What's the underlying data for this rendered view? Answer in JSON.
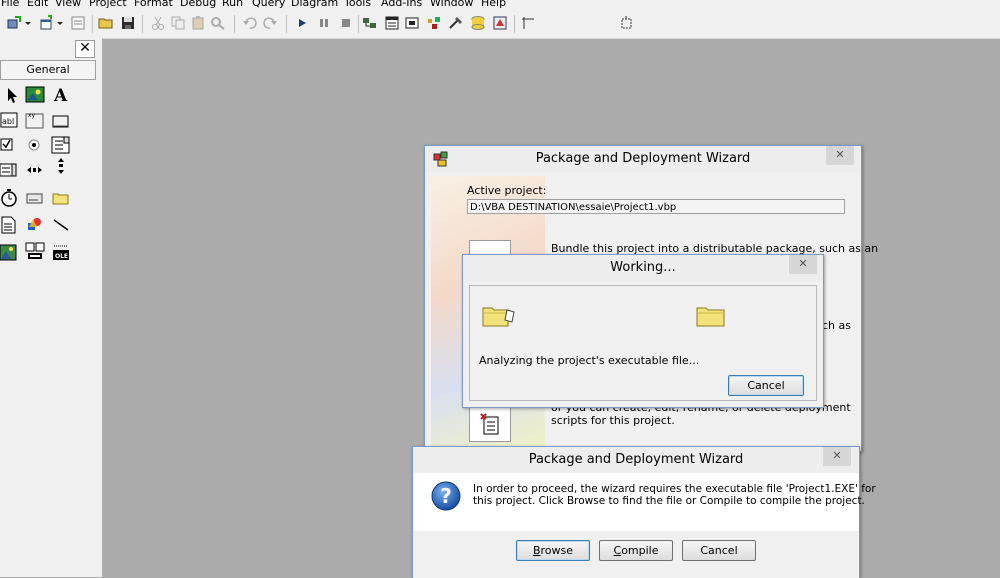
{
  "menu": [
    "File",
    "Edit",
    "View",
    "Project",
    "Format",
    "Debug",
    "Run",
    "Query",
    "Diagram",
    "Tools",
    "Add-Ins",
    "Window",
    "Help"
  ],
  "toolbox": {
    "close_label": "✕",
    "general_label": "General"
  },
  "wizard": {
    "title": "Package and Deployment Wizard",
    "active_project_label": "Active project:",
    "active_project_value": "D:\\VBA DESTINATION\\essaie\\Project1.vbp",
    "bundle_text": "Bundle this project into a distributable package, such as an",
    "partial_text": "ch as",
    "scripts_text_1": "or you can create, edit, rename, or delete deployment",
    "scripts_text_2": "scripts for this project."
  },
  "working": {
    "title": "Working...",
    "status": "Analyzing the project's executable file...",
    "cancel": "Cancel"
  },
  "prompt": {
    "title": "Package and Deployment Wizard",
    "message_line1": "In order to proceed, the wizard requires the executable file 'Project1.EXE' for",
    "message_line2": "this project. Click Browse to find the file or Compile to compile the project.",
    "browse_first": "B",
    "browse_rest": "rowse",
    "compile_first": "C",
    "compile_rest": "ompile",
    "cancel": "Cancel"
  },
  "colors": {
    "workspace": "#ababab",
    "chrome": "#f0f0f0",
    "folder": "#f2e27a"
  },
  "icons": [
    "select-pointer-icon",
    "picturebox-icon",
    "label-icon",
    "textbox-icon",
    "frame-icon",
    "commandbutton-icon",
    "checkbox-icon",
    "optionbutton-icon",
    "combobox-icon",
    "listbox-icon",
    "hscrollbar-icon",
    "vscrollbar-icon",
    "timer-icon",
    "drivelistbox-icon",
    "dirlistbox-icon",
    "filelistbox-icon",
    "shape-icon",
    "line-icon",
    "image-icon",
    "data-icon",
    "ole-icon",
    "question-icon",
    "folder-icon"
  ]
}
